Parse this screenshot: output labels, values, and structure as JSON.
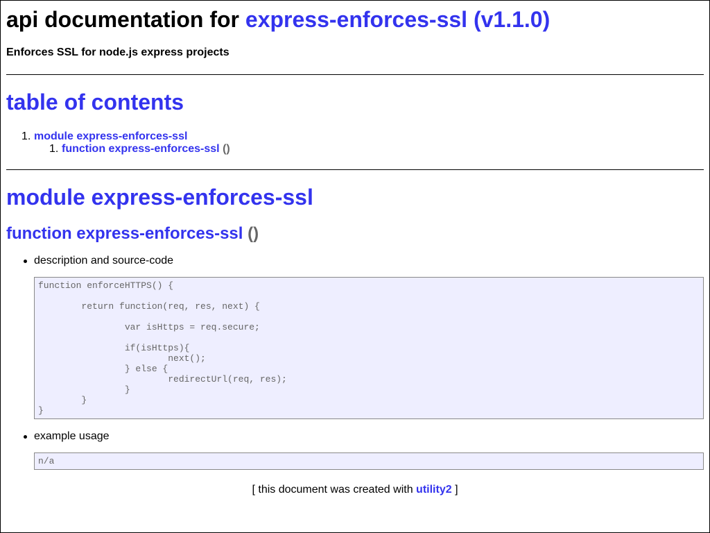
{
  "header": {
    "title_prefix": "api documentation for",
    "title_link": "express-enforces-ssl (v1.1.0)",
    "description": "Enforces SSL for node.js express projects"
  },
  "toc": {
    "heading": "table of contents",
    "items": [
      {
        "num": "1.",
        "label": "module express-enforces-ssl"
      }
    ],
    "subitems": [
      {
        "num": "1.",
        "label": "function express-enforces-ssl",
        "paren": "()"
      }
    ]
  },
  "module": {
    "heading": "module express-enforces-ssl",
    "function_heading": "function express-enforces-ssl",
    "function_paren": "()",
    "description_label": "description and source-code",
    "source_code": "function enforceHTTPS() {\n\n        return function(req, res, next) {\n\n                var isHttps = req.secure;\n\n                if(isHttps){\n                        next();\n                } else {\n                        redirectUrl(req, res);\n                }\n        }\n}",
    "example_label": "example usage",
    "example_code": "n/a"
  },
  "footer": {
    "prefix": "[ this document was created with",
    "link": "utility2",
    "suffix": "]"
  },
  "colors": {
    "link": "#3333ee",
    "code_bg": "#eeeeff",
    "code_text": "#666666"
  }
}
